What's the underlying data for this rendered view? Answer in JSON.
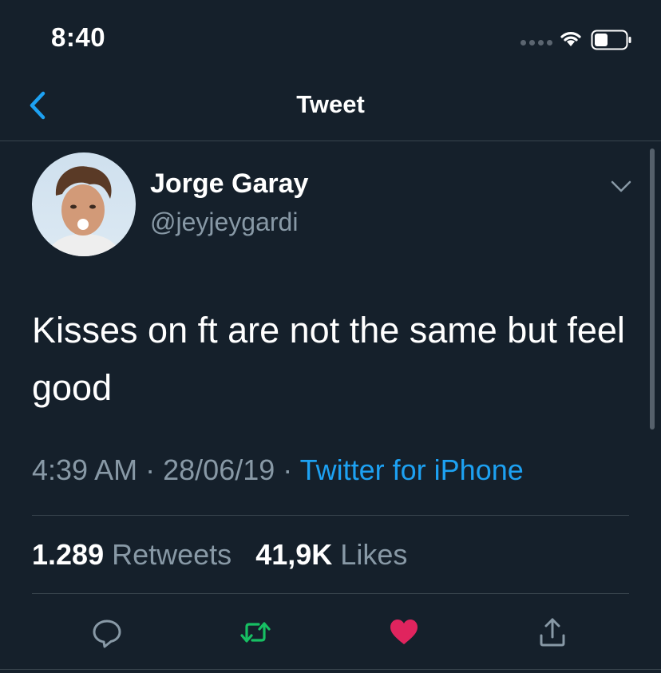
{
  "status_bar": {
    "time": "8:40"
  },
  "nav": {
    "title": "Tweet",
    "back_icon": "chevron-left-icon"
  },
  "tweet": {
    "author": {
      "name": "Jorge Garay",
      "handle": "@jeyjeygardi"
    },
    "text": "Kisses on ft are not the same but feel good",
    "time": "4:39 AM",
    "separator": "·",
    "date": "28/06/19",
    "source": "Twitter for iPhone",
    "retweets_count": "1.289",
    "retweets_label": "Retweets",
    "likes_count": "41,9K",
    "likes_label": "Likes"
  },
  "actions": [
    "reply-icon",
    "retweet-icon",
    "like-icon",
    "share-icon"
  ],
  "colors": {
    "background": "#15202b",
    "accent": "#1da1f2",
    "muted": "#8899a6",
    "retweet": "#17bf63",
    "like": "#e0245e"
  }
}
